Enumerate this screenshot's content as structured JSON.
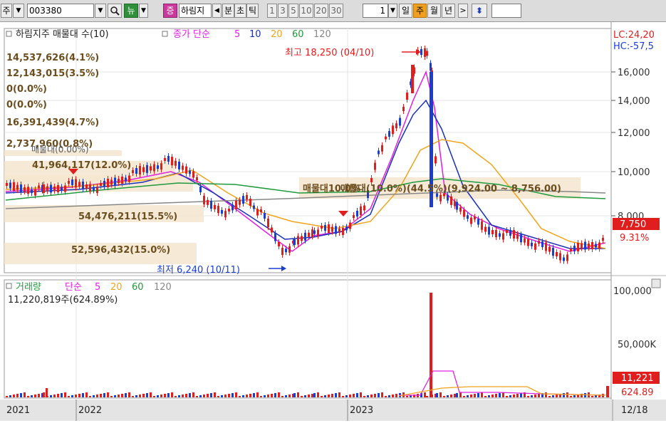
{
  "toolbar": {
    "market_label": "주",
    "code": "003380",
    "news_label": "뉴",
    "tag_label": "증",
    "name_label": "하림지",
    "tabs": [
      "분",
      "초",
      "틱"
    ],
    "numbers": [
      "1",
      "3",
      "5",
      "10",
      "20",
      "30"
    ],
    "count_value": "1",
    "periods": [
      "일",
      "주",
      "월",
      "년"
    ],
    "selected_period": "주",
    "arrow_icon": "updown-arrow-icon"
  },
  "price_panel": {
    "title": "하림지주 매물대 수(10)",
    "ma_label": "종가 단순",
    "ma_periods": [
      "5",
      "10",
      "20",
      "60",
      "120"
    ],
    "ma_colors": [
      "#e020e0",
      "#1a2fb8",
      "#f0a41c",
      "#1f9a3c",
      "#888888"
    ],
    "lc_label": "LC:24,20",
    "hc_label": "HC:-57,5",
    "y_ticks": [
      "16,000",
      "14,000",
      "12,000",
      "10,000",
      "8,000"
    ],
    "current_price": "7,750",
    "current_change": "9.31%",
    "high_annotation": "최고 18,250 (04/10)",
    "low_annotation": "최저 6,240 (10/11)",
    "volume_profile": [
      "14,537,626(4.1%)",
      "12,143,015(3.5%)",
      "0(0.0%)",
      "0(0.0%)",
      "16,391,439(4.7%)",
      "2,737,960(0.8%)",
      "41,964,117(12.0%)",
      "54,476,211(15.5%)",
      "52,596,432(15.0%)"
    ],
    "overlap_label_a": "매물대(0.00%)",
    "overlap_label_b": "매물대10.0%",
    "max_band_label": "매물대(10.0%)(44.5%)(9,924.00 ~ 8,756.00)"
  },
  "volume_panel": {
    "title": "거래량",
    "ma_label": "단순",
    "ma_periods": [
      "5",
      "20",
      "60",
      "120"
    ],
    "ma_colors": [
      "#e020e0",
      "#f0a41c",
      "#1f9a3c",
      "#888888"
    ],
    "value_label": "11,220,819주(624.89%)",
    "y_ticks": [
      "100,000",
      "50,000K"
    ],
    "current_volume": "11,221",
    "current_pct": "624.89"
  },
  "x_axis": {
    "labels": [
      "2021",
      "2022",
      "2023"
    ],
    "last_date": "12/18"
  }
}
